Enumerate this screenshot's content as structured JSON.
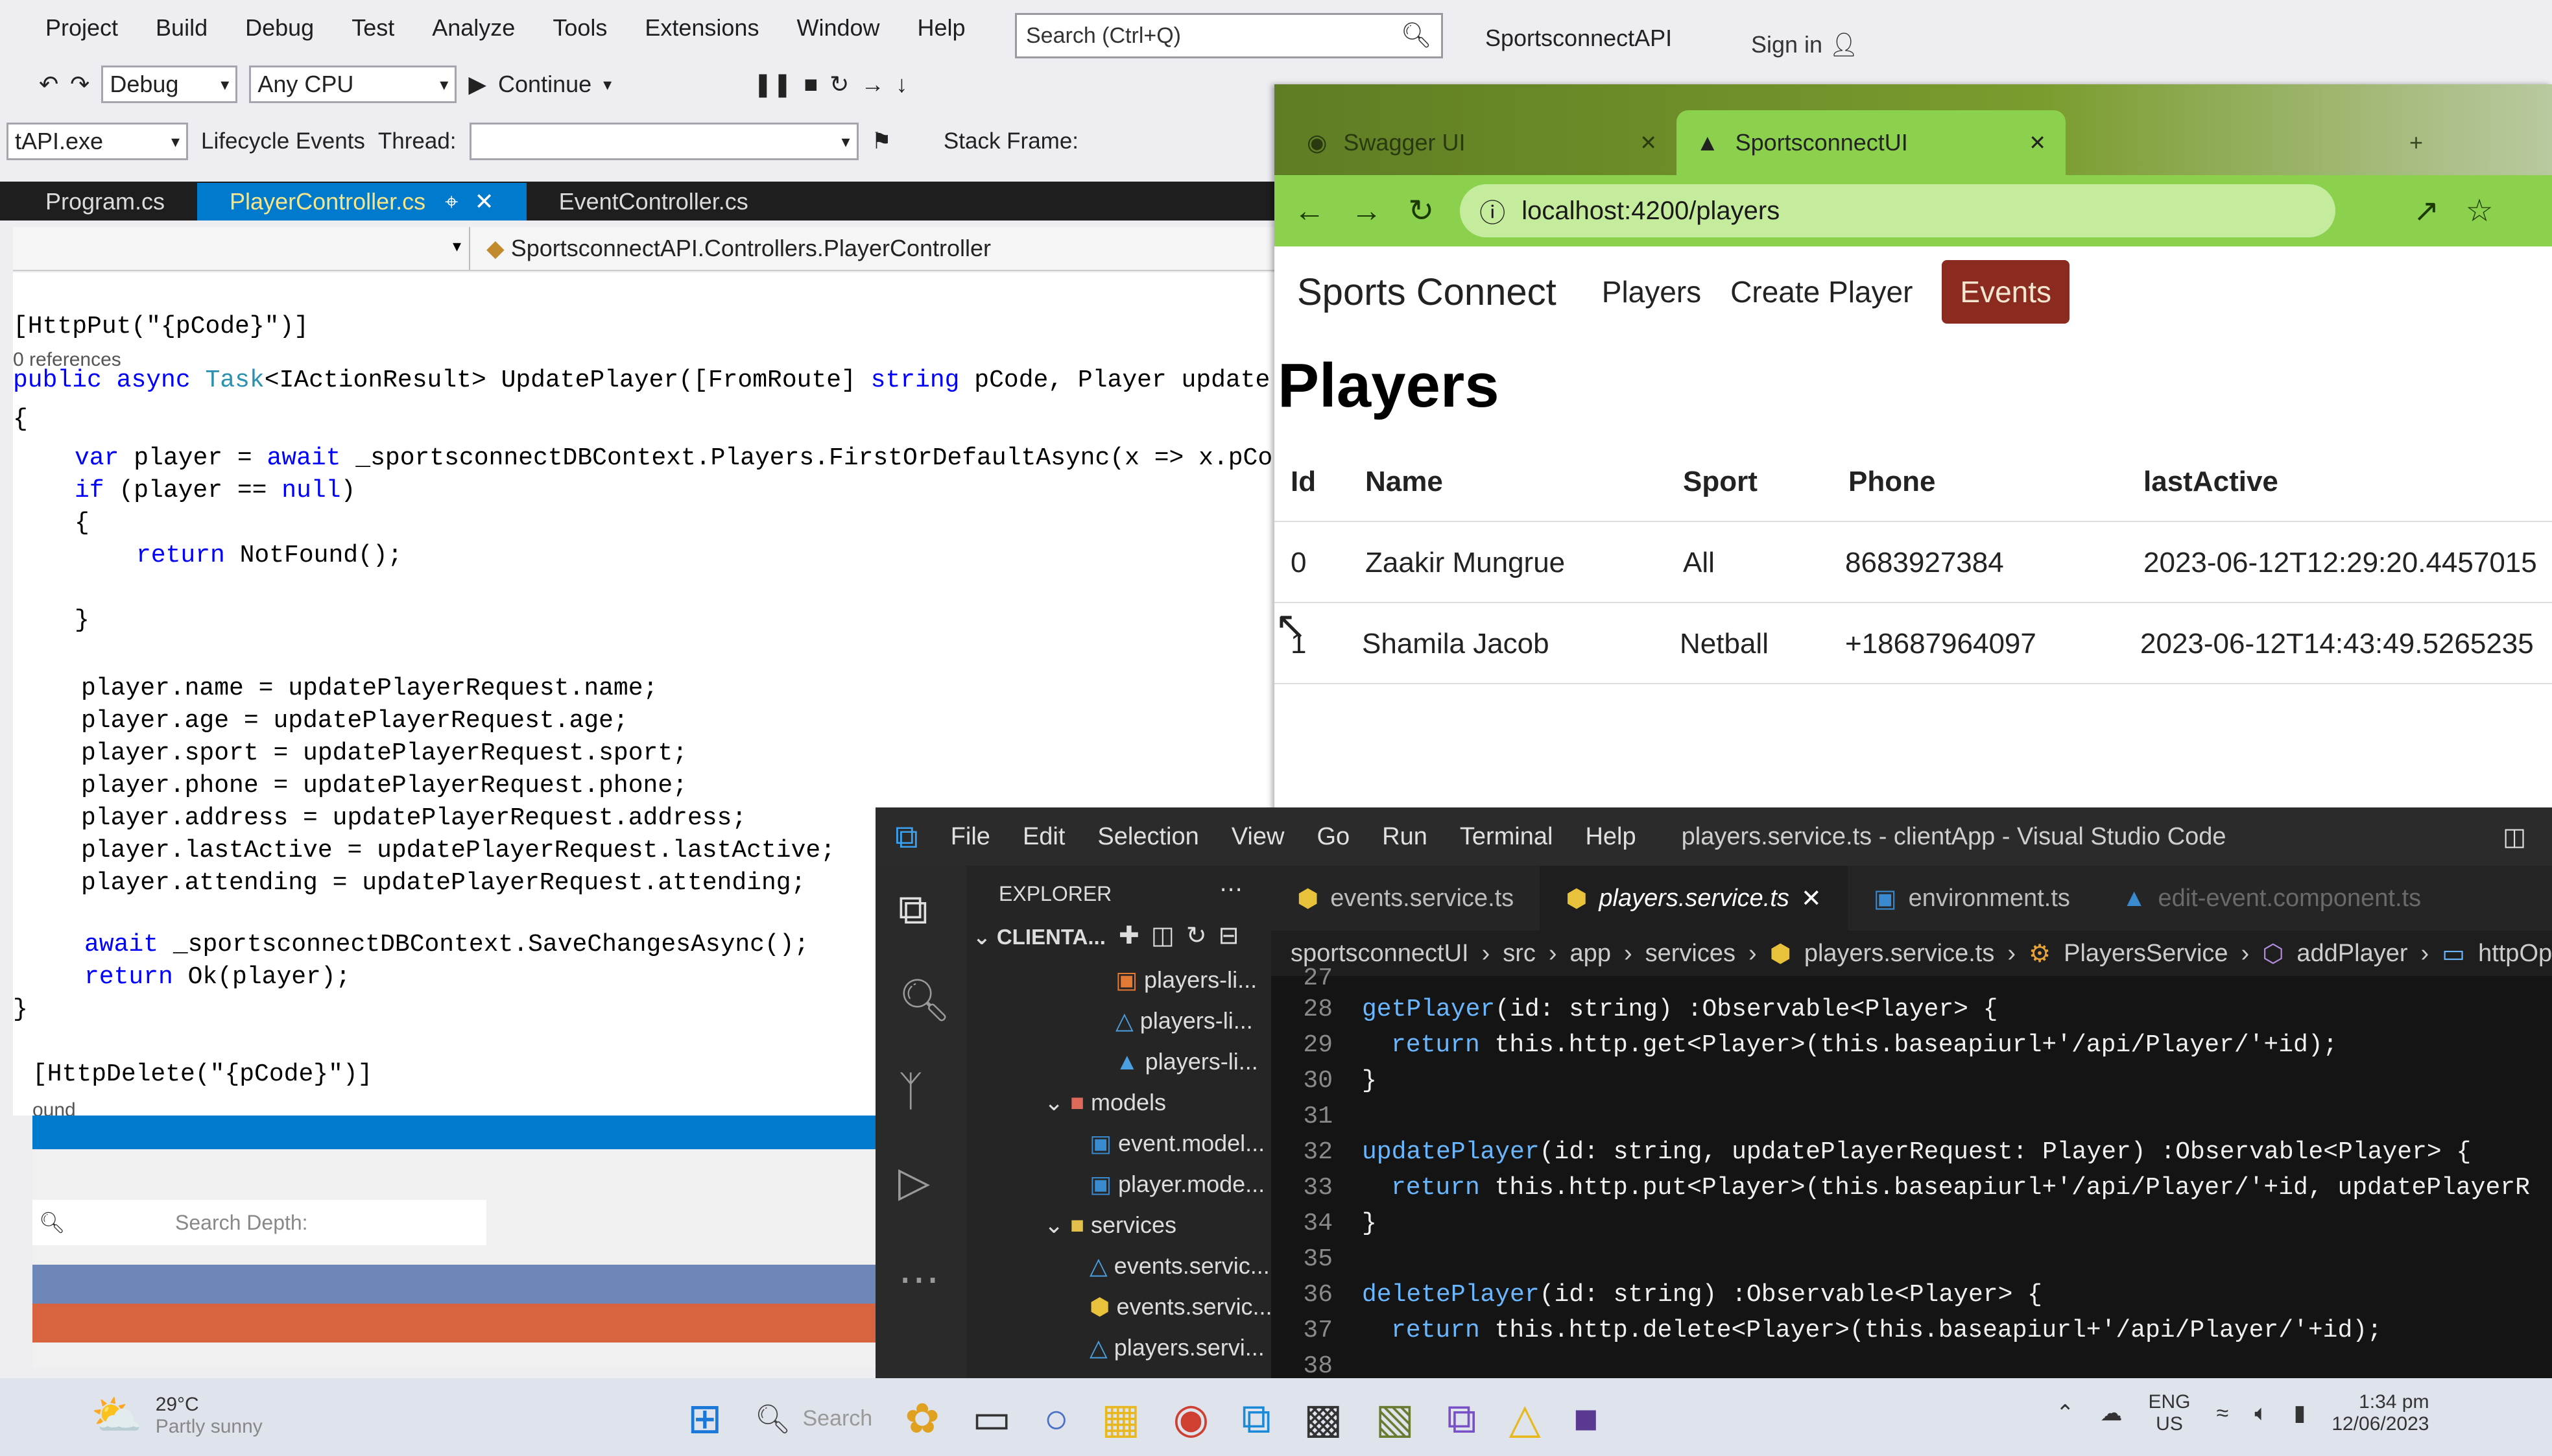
{
  "vs": {
    "menu": [
      "Project",
      "Build",
      "Debug",
      "Test",
      "Analyze",
      "Tools",
      "Extensions",
      "Window",
      "Help"
    ],
    "search_placeholder": "Search (Ctrl+Q)",
    "project_name": "SportsconnectAPI",
    "sign_in": "Sign in",
    "config": "Debug",
    "platform": "Any CPU",
    "continue_label": "Continue",
    "process": "tAPI.exe",
    "lifecycle": "Lifecycle Events",
    "thread_label": "Thread:",
    "stack_frame_label": "Stack Frame:",
    "tabs": [
      "Program.cs",
      "PlayerController.cs",
      "EventController.cs"
    ],
    "nav_path": "SportsconnectAPI.Controllers.PlayerController",
    "code": {
      "attr_put": "[HttpPut(\"{pCode}\")]",
      "refs": "0 references",
      "sig_public": "public",
      "sig_async": "async",
      "sig_task": "Task",
      "sig_rest": "<IActionResult> UpdatePlayer([FromRoute] ",
      "sig_string": "string",
      "sig_tail": " pCode, Player update",
      "brace_open": "{",
      "var_line_kw": "var",
      "var_line_rest": " player = ",
      "await_kw": "await",
      "var_line_end": " _sportsconnectDBContext.Players.FirstOrDefaultAsync(x => x.pCo",
      "if_kw": "if",
      "if_rest": " (player == ",
      "null_kw": "null",
      "if_close": ")",
      "inner_open": "{",
      "return_kw": "return",
      "notfound": " NotFound();",
      "inner_close": "}",
      "assign_name": "player.name = updatePlayerRequest.name;",
      "assign_age": "player.age = updatePlayerRequest.age;",
      "assign_sport": "player.sport = updatePlayerRequest.sport;",
      "assign_phone": "player.phone = updatePlayerRequest.phone;",
      "assign_address": "player.address = updatePlayerRequest.address;",
      "assign_active": "player.lastActive = updatePlayerRequest.lastActive;",
      "assign_attending": "player.attending = updatePlayerRequest.attending;",
      "save_rest": " _sportsconnectDBContext.SaveChangesAsync();",
      "ok_rest": " Ok(player);",
      "brace_close": "}",
      "attr_delete": "[HttpDelete(\"{pCode}\")]",
      "status_found": "ound"
    },
    "output_search_depth": "Search Depth:"
  },
  "browser": {
    "tabs": [
      "Swagger UI",
      "SportsconnectUI"
    ],
    "url": "localhost:4200/players",
    "brand": "Sports Connect",
    "nav": [
      "Players",
      "Create Player",
      "Events"
    ],
    "page_title": "Players",
    "columns": [
      "Id",
      "Name",
      "Sport",
      "Phone",
      "lastActive"
    ],
    "rows": [
      [
        "0",
        "Zaakir Mungrue",
        "All",
        "8683927384",
        "2023-06-12T12:29:20.4457015"
      ],
      [
        "1",
        "Shamila Jacob",
        "Netball",
        "+18687964097",
        "2023-06-12T14:43:49.5265235"
      ]
    ]
  },
  "vscode": {
    "menu": [
      "File",
      "Edit",
      "Selection",
      "View",
      "Go",
      "Run",
      "Terminal",
      "Help"
    ],
    "title": "players.service.ts - clientApp - Visual Studio Code",
    "explorer_label": "EXPLORER",
    "root": "CLIENTA...",
    "tree": [
      "players-li...",
      "players-li...",
      "players-li...",
      "models",
      "event.model...",
      "player.mode...",
      "services",
      "events.servic...",
      "events.servic...",
      "players.servi..."
    ],
    "tabs": [
      "events.service.ts",
      "players.service.ts",
      "environment.ts",
      "edit-event.component.ts"
    ],
    "breadcrumb": [
      "sportsconnectUI",
      "src",
      "app",
      "services",
      "players.service.ts",
      "PlayersService",
      "addPlayer",
      "httpOptio"
    ],
    "lines": [
      "27",
      "28",
      "29",
      "30",
      "31",
      "32",
      "33",
      "34",
      "35",
      "36",
      "37",
      "38"
    ],
    "code": {
      "l28_fn": "getPlayer",
      "l28_rest": "(id: string) :Observable<Player> {",
      "l29_return": "return",
      "l29_rest": " this.http.get<Player>(this.baseapiurl+'/api/Player/'+id);",
      "l30": "}",
      "l32_fn": "updatePlayer",
      "l32_rest": "(id: string, updatePlayerRequest: Player) :Observable<Player> {",
      "l33_return": "return",
      "l33_rest": " this.http.put<Player>(this.baseapiurl+'/api/Player/'+id, updatePlayerR",
      "l34": "}",
      "l36_fn": "deletePlayer",
      "l36_rest": "(id: string) :Observable<Player> {",
      "l37_return": "return",
      "l37_rest": " this.http.delete<Player>(this.baseapiurl+'/api/Player/'+id);"
    }
  },
  "taskbar": {
    "temp": "29°C",
    "weather": "Partly sunny",
    "search": "Search",
    "lang1": "ENG",
    "lang2": "US",
    "time": "1:34 pm",
    "date": "12/06/2023"
  }
}
